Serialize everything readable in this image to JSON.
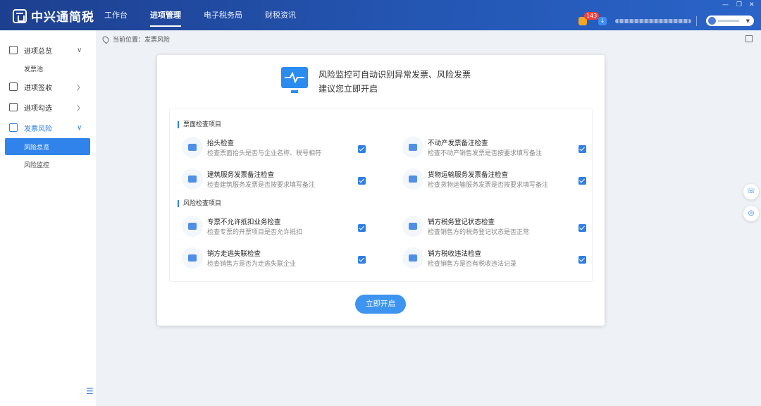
{
  "app": {
    "name": "中兴通简税"
  },
  "topnav": [
    {
      "label": "工作台",
      "active": false
    },
    {
      "label": "进项管理",
      "active": true
    },
    {
      "label": "电子税务局",
      "active": false
    },
    {
      "label": "财税资讯",
      "active": false
    }
  ],
  "header": {
    "notification_count": "143"
  },
  "sidebar": {
    "groups": [
      {
        "label": "进项总览",
        "chevron": "v"
      },
      {
        "label": "进项签收",
        "chevron": ">"
      },
      {
        "label": "进项勾选",
        "chevron": ">"
      },
      {
        "label": "发票风险",
        "chevron": "v"
      }
    ],
    "sub": {
      "invoice_pool": "发票池",
      "risk_overview": "风险总览",
      "risk_monitor": "风险监控"
    }
  },
  "breadcrumb": {
    "text": "当前位置：发票风险"
  },
  "hero": {
    "line1": "风险监控可自动识别异常发票、风险发票",
    "line2": "建议您立即开启"
  },
  "sections": [
    {
      "title": "票面检查项目",
      "items": [
        {
          "name": "抬头检查",
          "desc": "检查票面抬头是否与企业名称、税号相符",
          "checked": true
        },
        {
          "name": "不动产发票备注检查",
          "desc": "检查不动产销售发票是否按要求填写备注",
          "checked": true
        },
        {
          "name": "建筑服务发票备注检查",
          "desc": "检查建筑服务发票是否按要求填写备注",
          "checked": true
        },
        {
          "name": "货物运输服务发票备注检查",
          "desc": "检查货物运输服务发票是否按要求填写备注",
          "checked": true
        }
      ]
    },
    {
      "title": "风险检查项目",
      "items": [
        {
          "name": "专票不允许抵扣业务检查",
          "desc": "检查专票的开票项目是否允许抵扣",
          "checked": true
        },
        {
          "name": "销方税务登记状态检查",
          "desc": "检查销售方的税务登记状态是否正常",
          "checked": true
        },
        {
          "name": "销方走逃失联检查",
          "desc": "检查销售方是否为走逃失联企业",
          "checked": true
        },
        {
          "name": "销方税收违法检查",
          "desc": "检查销售方是否有税收违法记录",
          "checked": true
        }
      ]
    }
  ],
  "actions": {
    "start_label": "立即开启"
  },
  "colors": {
    "accent": "#2f7fe6",
    "header": "#2456b3"
  }
}
